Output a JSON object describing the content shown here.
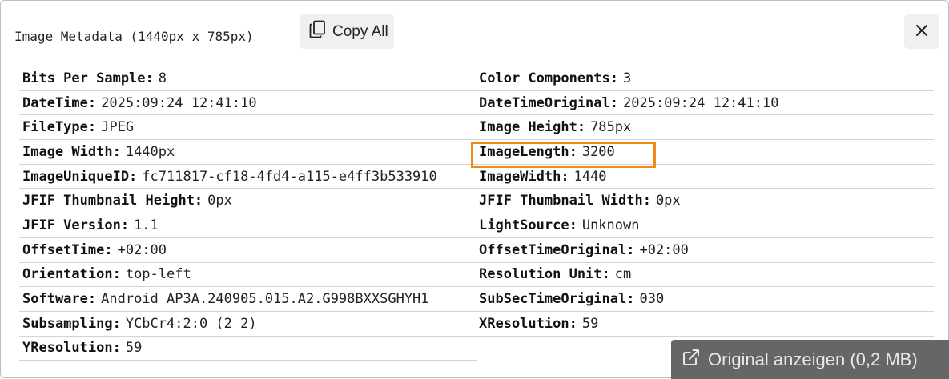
{
  "dialog": {
    "title": "Image Metadata (1440px x 785px)",
    "copy_all_label": "Copy All",
    "copy_icon": "copy-icon",
    "close_icon": "close-icon"
  },
  "metadata": {
    "left": [
      {
        "key": "Bits Per Sample:",
        "value": "8"
      },
      {
        "key": "DateTime:",
        "value": "2025:09:24 12:41:10"
      },
      {
        "key": "FileType:",
        "value": "JPEG"
      },
      {
        "key": "Image Width:",
        "value": "1440px"
      },
      {
        "key": "ImageUniqueID:",
        "value": "fc711817-cf18-4fd4-a115-e4ff3b533910"
      },
      {
        "key": "JFIF Thumbnail Height:",
        "value": "0px"
      },
      {
        "key": "JFIF Version:",
        "value": "1.1"
      },
      {
        "key": "OffsetTime:",
        "value": "+02:00"
      },
      {
        "key": "Orientation:",
        "value": "top-left"
      },
      {
        "key": "Software:",
        "value": "Android AP3A.240905.015.A2.G998BXXSGHYH1"
      },
      {
        "key": "Subsampling:",
        "value": "YCbCr4:2:0 (2 2)"
      },
      {
        "key": "YResolution:",
        "value": "59"
      }
    ],
    "right": [
      {
        "key": "Color Components:",
        "value": "3"
      },
      {
        "key": "DateTimeOriginal:",
        "value": "2025:09:24 12:41:10"
      },
      {
        "key": "Image Height:",
        "value": "785px"
      },
      {
        "key": "ImageLength:",
        "value": "3200"
      },
      {
        "key": "ImageWidth:",
        "value": "1440"
      },
      {
        "key": "JFIF Thumbnail Width:",
        "value": "0px"
      },
      {
        "key": "LightSource:",
        "value": "Unknown"
      },
      {
        "key": "OffsetTimeOriginal:",
        "value": "+02:00"
      },
      {
        "key": "Resolution Unit:",
        "value": "cm"
      },
      {
        "key": "SubSecTimeOriginal:",
        "value": "030"
      },
      {
        "key": "XResolution:",
        "value": "59"
      }
    ]
  },
  "highlight_color": "#f08a1a",
  "footer": {
    "original_button_label": "Original anzeigen (0,2 MB)",
    "external_icon": "external-link-icon"
  }
}
